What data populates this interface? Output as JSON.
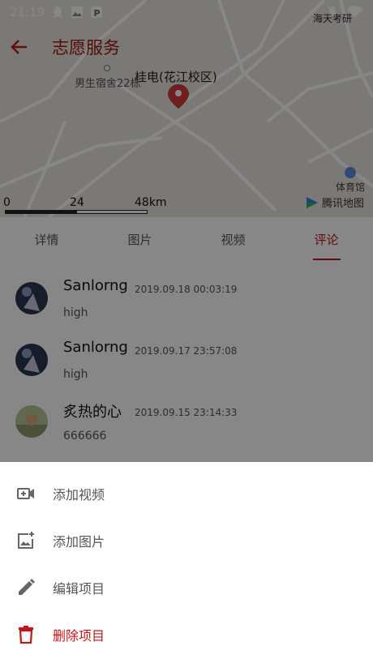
{
  "status_bar": {
    "time": "21:19",
    "carrier": "海天考研"
  },
  "header": {
    "title": "志愿服务"
  },
  "map": {
    "dorm_label": "男生宿舍22栋",
    "place_label": "桂电(花江校区)",
    "venue_label": "体育馆",
    "provider": "腾讯地图",
    "scale": {
      "ticks": [
        "0",
        "24",
        "48km"
      ]
    }
  },
  "tabs": [
    {
      "label": "详情",
      "active": false
    },
    {
      "label": "图片",
      "active": false
    },
    {
      "label": "视频",
      "active": false
    },
    {
      "label": "评论",
      "active": true
    }
  ],
  "comments": [
    {
      "name": "Sanlorng",
      "time": "2019.09.18 00:03:19",
      "text": "high"
    },
    {
      "name": "Sanlorng",
      "time": "2019.09.17 23:57:08",
      "text": "high"
    },
    {
      "name": "炙热的心",
      "time": "2019.09.15 23:14:33",
      "text": "666666"
    }
  ],
  "sheet": {
    "items": [
      {
        "label": "添加视频",
        "icon": "add-video-icon"
      },
      {
        "label": "添加图片",
        "icon": "add-image-icon"
      },
      {
        "label": "编辑项目",
        "icon": "edit-pencil-icon"
      },
      {
        "label": "删除项目",
        "icon": "delete-trash-icon"
      }
    ]
  },
  "colors": {
    "accent": "#c0151b",
    "title": "#a31515"
  }
}
